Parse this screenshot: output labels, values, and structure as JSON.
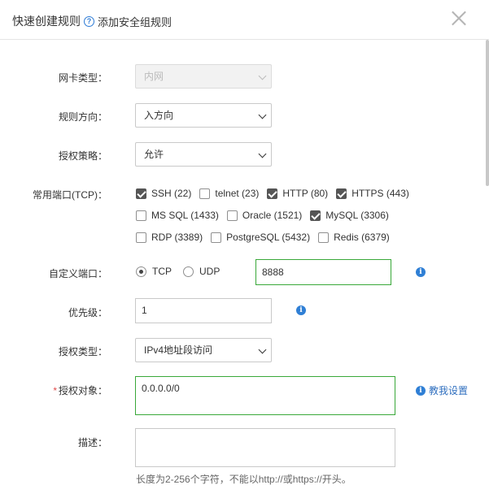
{
  "header": {
    "title": "快速创建规则",
    "help_link": "添加安全组规则"
  },
  "form": {
    "nic_type": {
      "label": "网卡类型：",
      "value": "内网"
    },
    "direction": {
      "label": "规则方向：",
      "value": "入方向"
    },
    "policy": {
      "label": "授权策略：",
      "value": "允许"
    },
    "ports": {
      "label": "常用端口(TCP)：",
      "options": [
        {
          "label": "SSH (22)",
          "checked": true
        },
        {
          "label": "telnet (23)",
          "checked": false
        },
        {
          "label": "HTTP (80)",
          "checked": true
        },
        {
          "label": "HTTPS (443)",
          "checked": true
        },
        {
          "label": "MS SQL (1433)",
          "checked": false
        },
        {
          "label": "Oracle (1521)",
          "checked": false
        },
        {
          "label": "MySQL (3306)",
          "checked": true
        },
        {
          "label": "RDP (3389)",
          "checked": false
        },
        {
          "label": "PostgreSQL (5432)",
          "checked": false
        },
        {
          "label": "Redis (6379)",
          "checked": false
        }
      ]
    },
    "custom_port": {
      "label": "自定义端口：",
      "protocol_tcp": "TCP",
      "protocol_udp": "UDP",
      "selected": "TCP",
      "value": "8888"
    },
    "priority": {
      "label": "优先级：",
      "value": "1"
    },
    "auth_type": {
      "label": "授权类型：",
      "value": "IPv4地址段访问"
    },
    "auth_object": {
      "required_mark": "*",
      "label": "授权对象：",
      "value": "0.0.0.0/0",
      "help_link": "教我设置"
    },
    "description": {
      "label": "描述：",
      "value": "",
      "hint": "长度为2-256个字符，不能以http://或https://开头。"
    }
  },
  "icons": {
    "info": "i",
    "help": "?"
  },
  "colors": {
    "accent": "#2f7fd5",
    "focus_border": "#39a839",
    "link": "#2f6fbf"
  }
}
